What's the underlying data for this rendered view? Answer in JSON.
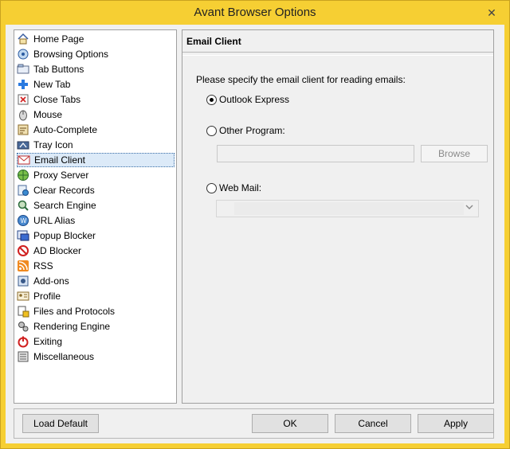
{
  "window": {
    "title": "Avant Browser Options",
    "close_glyph": "✕"
  },
  "tree": {
    "items": [
      {
        "label": "Home Page",
        "icon": "home-icon"
      },
      {
        "label": "Browsing Options",
        "icon": "browsing-options-icon"
      },
      {
        "label": "Tab Buttons",
        "icon": "tab-buttons-icon"
      },
      {
        "label": "New Tab",
        "icon": "plus-icon"
      },
      {
        "label": "Close Tabs",
        "icon": "close-tab-icon"
      },
      {
        "label": "Mouse",
        "icon": "mouse-icon"
      },
      {
        "label": "Auto-Complete",
        "icon": "auto-complete-icon"
      },
      {
        "label": "Tray Icon",
        "icon": "tray-icon"
      },
      {
        "label": "Email Client",
        "icon": "envelope-icon",
        "selected": true
      },
      {
        "label": "Proxy Server",
        "icon": "globe-icon"
      },
      {
        "label": "Clear Records",
        "icon": "clear-records-icon"
      },
      {
        "label": "Search Engine",
        "icon": "search-icon"
      },
      {
        "label": "URL Alias",
        "icon": "url-alias-icon"
      },
      {
        "label": "Popup Blocker",
        "icon": "popup-blocker-icon"
      },
      {
        "label": "AD Blocker",
        "icon": "no-entry-icon"
      },
      {
        "label": "RSS",
        "icon": "rss-icon"
      },
      {
        "label": "Add-ons",
        "icon": "add-ons-icon"
      },
      {
        "label": "Profile",
        "icon": "profile-icon"
      },
      {
        "label": "Files and Protocols",
        "icon": "files-icon"
      },
      {
        "label": "Rendering Engine",
        "icon": "gears-icon"
      },
      {
        "label": "Exiting",
        "icon": "power-icon"
      },
      {
        "label": "Miscellaneous",
        "icon": "misc-icon"
      }
    ]
  },
  "panel": {
    "header": "Email Client",
    "prompt": "Please specify the email client for reading emails:",
    "options": {
      "outlook": {
        "label": "Outlook Express",
        "selected": true
      },
      "other": {
        "label": "Other Program:",
        "selected": false
      },
      "webmail": {
        "label": "Web Mail:",
        "selected": false
      }
    },
    "other_program_value": "",
    "browse_label": "Browse",
    "webmail_value": ""
  },
  "footer": {
    "load_default": "Load Default",
    "ok": "OK",
    "cancel": "Cancel",
    "apply": "Apply"
  },
  "colors": {
    "titlebar": "#f6cf33",
    "selection": "#dceaf8"
  }
}
